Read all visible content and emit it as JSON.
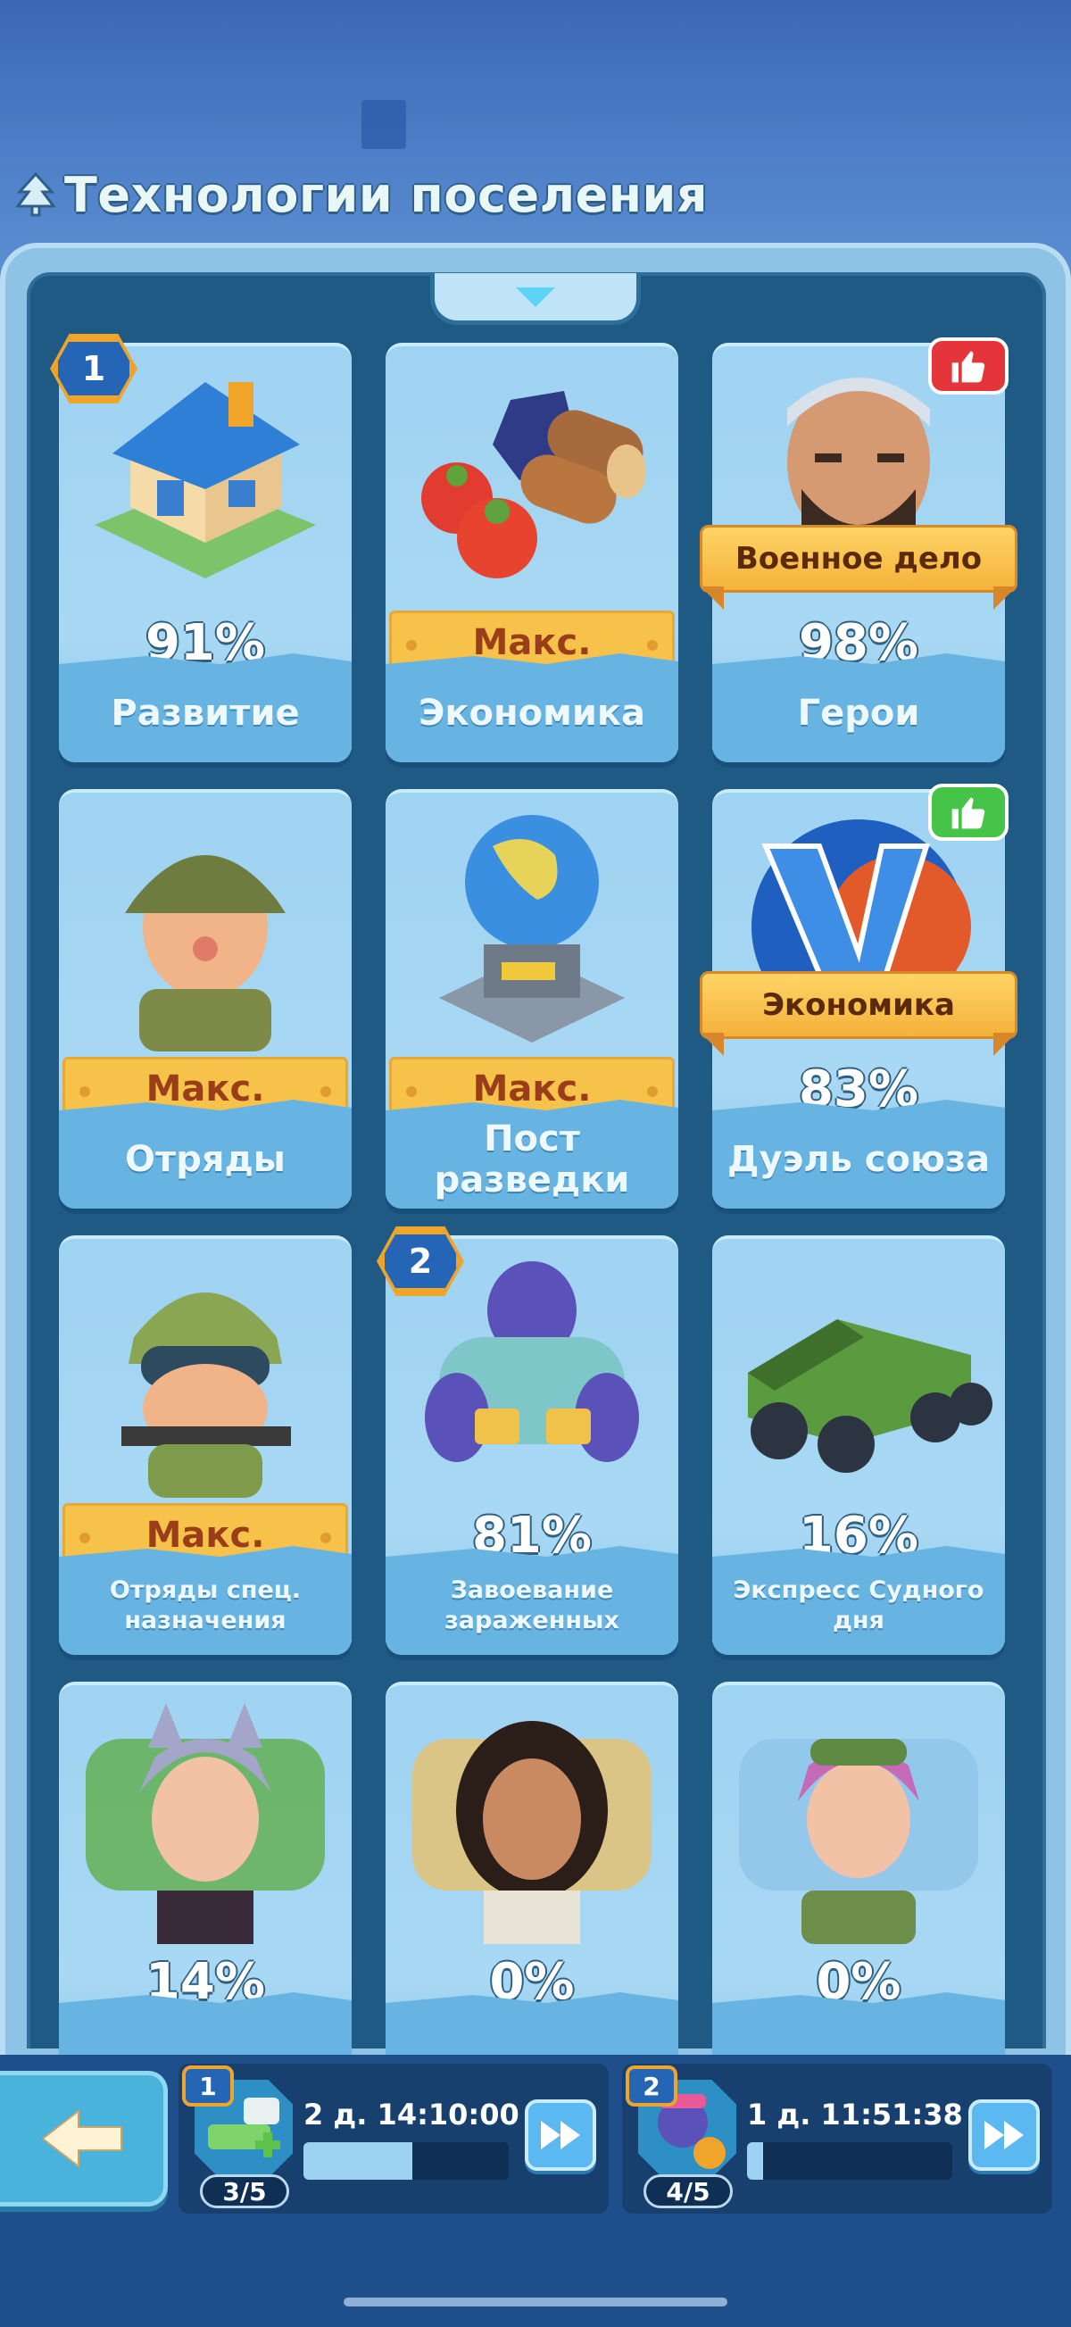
{
  "header": {
    "title": "Технологии поселения"
  },
  "cards": [
    {
      "label": "Развитие",
      "percent": "91%",
      "badge": "1"
    },
    {
      "label": "Экономика",
      "max": "Макс."
    },
    {
      "label": "Герои",
      "percent": "98%",
      "ribbon": "Военное дело",
      "recommend": "red"
    },
    {
      "label": "Отряды",
      "max": "Макс."
    },
    {
      "label": "Пост разведки",
      "max": "Макс."
    },
    {
      "label": "Дуэль союза",
      "percent": "83%",
      "ribbon": "Экономика",
      "recommend": "green"
    },
    {
      "label": "Отряды спец. назначения",
      "max": "Макс."
    },
    {
      "label": "Завоевание зараженных",
      "percent": "81%",
      "badge": "2"
    },
    {
      "label": "Экспресс Судного дня",
      "percent": "16%"
    },
    {
      "label": "",
      "percent": "14%"
    },
    {
      "label": "",
      "percent": "0%"
    },
    {
      "label": "",
      "percent": "0%"
    }
  ],
  "queues": [
    {
      "badge": "1",
      "time": "2 д. 14:10:00",
      "count": "3/5",
      "progress": 0.53
    },
    {
      "badge": "2",
      "time": "1 д. 11:51:38",
      "count": "4/5",
      "progress": 0.08
    }
  ],
  "icons": {
    "back": "arrow-left-icon",
    "fast_forward": "fast-forward-icon",
    "thumb_up": "thumbs-up-icon"
  },
  "colors": {
    "accent": "#f7c24a",
    "card": "#a8d8f3",
    "panel": "#1f5a85"
  }
}
